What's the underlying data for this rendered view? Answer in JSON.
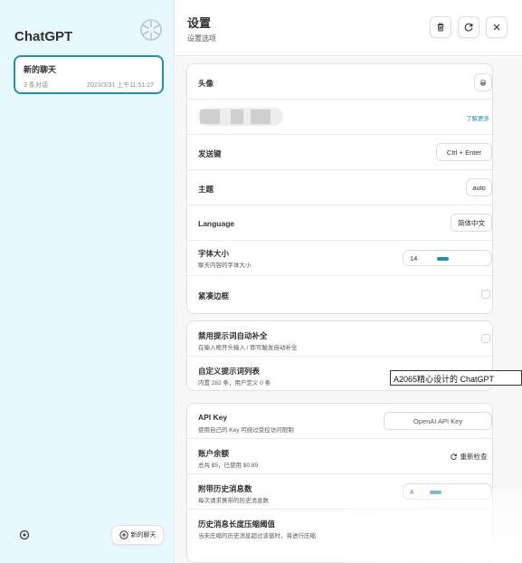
{
  "sidebar": {
    "app_title": "ChatGPT",
    "chat_item": {
      "title": "新的聊天",
      "count": "3 条对话",
      "time": "2023/3/31 上午11:51:27"
    },
    "new_chat_label": "新的聊天"
  },
  "header": {
    "title": "设置",
    "subtitle": "设置选项"
  },
  "settings": {
    "avatar": {
      "label": "头像",
      "emoji": "😀"
    },
    "update": {
      "learn_more": "了解更多"
    },
    "send_key": {
      "label": "发送键",
      "value": "Ctrl + Enter"
    },
    "theme": {
      "label": "主题",
      "value": "auto"
    },
    "language": {
      "label": "Language",
      "value": "简体中文"
    },
    "font_size": {
      "label": "字体大小",
      "sub": "聊天内容的字体大小",
      "value": "14",
      "fraction": 0.25
    },
    "tight_border": {
      "label": "紧凑边框"
    },
    "disable_prompt": {
      "label": "禁用提示词自动补全",
      "sub": "在输入框开头输入 / 即可触发自动补全"
    },
    "custom_prompt": {
      "label": "自定义提示词列表",
      "sub": "内置 282 条，用户定义 0 条"
    },
    "api_key": {
      "label": "API Key",
      "sub": "使用自己的 Key 可绕过受控访问限制",
      "placeholder": "OpenAI API Key"
    },
    "balance": {
      "label": "账户余额",
      "sub": "总共 $5，已使用 $0.89",
      "button": "重新检查"
    },
    "history_count": {
      "label": "附带历史消息数",
      "sub": "每次请求携带的历史消息数",
      "value": "4",
      "fraction": 0.12
    },
    "compress": {
      "label": "历史消息长度压缩阈值",
      "sub": "当未压缩的历史消息超过该值时，将进行压缩"
    }
  },
  "tooltip": "A2065精心设计的 ChatGPT",
  "colors": {
    "accent": "#1d93ab",
    "sidebar_bg": "#e7f8ff"
  }
}
